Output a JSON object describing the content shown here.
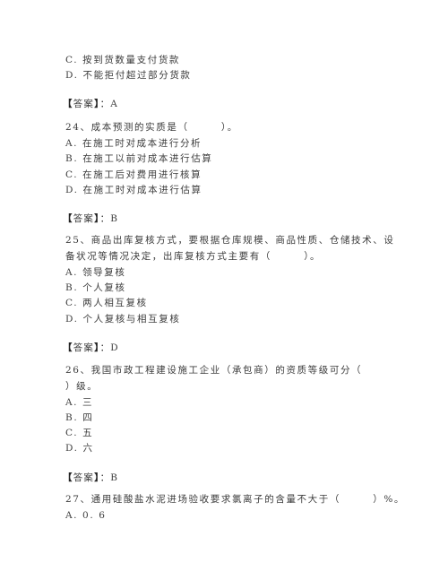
{
  "page": {
    "lines": [
      {
        "id": "q23-opt-c",
        "text": "C. 按到货数量支付货款"
      },
      {
        "id": "q23-opt-d",
        "text": "D. 不能拒付超过部分货款"
      },
      {
        "id": "q23-answer",
        "label_open": "【",
        "label": "答案",
        "label_close": "】",
        "sep": "：",
        "value": "A"
      },
      {
        "id": "q24-stem",
        "text": "24、成本预测的实质是（　　　）。"
      },
      {
        "id": "q24-opt-a",
        "text": "A. 在施工时对成本进行分析"
      },
      {
        "id": "q24-opt-b",
        "text": "B. 在施工以前对成本进行估算"
      },
      {
        "id": "q24-opt-c",
        "text": "C. 在施工后对费用进行核算"
      },
      {
        "id": "q24-opt-d",
        "text": "D. 在施工时对成本进行估算"
      },
      {
        "id": "q24-answer",
        "label_open": "【",
        "label": "答案",
        "label_close": "】",
        "sep": "：",
        "value": "B"
      },
      {
        "id": "q25-stem-1",
        "text": "25、商品出库复核方式，要根据仓库规模、商品性质、仓储技术、设"
      },
      {
        "id": "q25-stem-2",
        "text": "备状况等情况决定，出库复核方式主要有（　　　）。"
      },
      {
        "id": "q25-opt-a",
        "text": "A. 领导复核"
      },
      {
        "id": "q25-opt-b",
        "text": "B. 个人复核"
      },
      {
        "id": "q25-opt-c",
        "text": "C. 两人相互复核"
      },
      {
        "id": "q25-opt-d",
        "text": "D. 个人复核与相互复核"
      },
      {
        "id": "q25-answer",
        "label_open": "【",
        "label": "答案",
        "label_close": "】",
        "sep": "：",
        "value": "D"
      },
      {
        "id": "q26-stem-1",
        "text": "26、我国市政工程建设施工企业（承包商）的资质等级可分（"
      },
      {
        "id": "q26-stem-2",
        "text": "）级。"
      },
      {
        "id": "q26-opt-a",
        "text": "A. 三"
      },
      {
        "id": "q26-opt-b",
        "text": "B. 四"
      },
      {
        "id": "q26-opt-c",
        "text": "C. 五"
      },
      {
        "id": "q26-opt-d",
        "text": "D. 六"
      },
      {
        "id": "q26-answer",
        "label_open": "【",
        "label": "答案",
        "label_close": "】",
        "sep": "：",
        "value": "B"
      },
      {
        "id": "q27-stem",
        "text": "27、通用硅酸盐水泥进场验收要求氯离子的含量不大于（　　　）%。"
      },
      {
        "id": "q27-opt-a",
        "text": "A. 0. 6"
      }
    ]
  }
}
